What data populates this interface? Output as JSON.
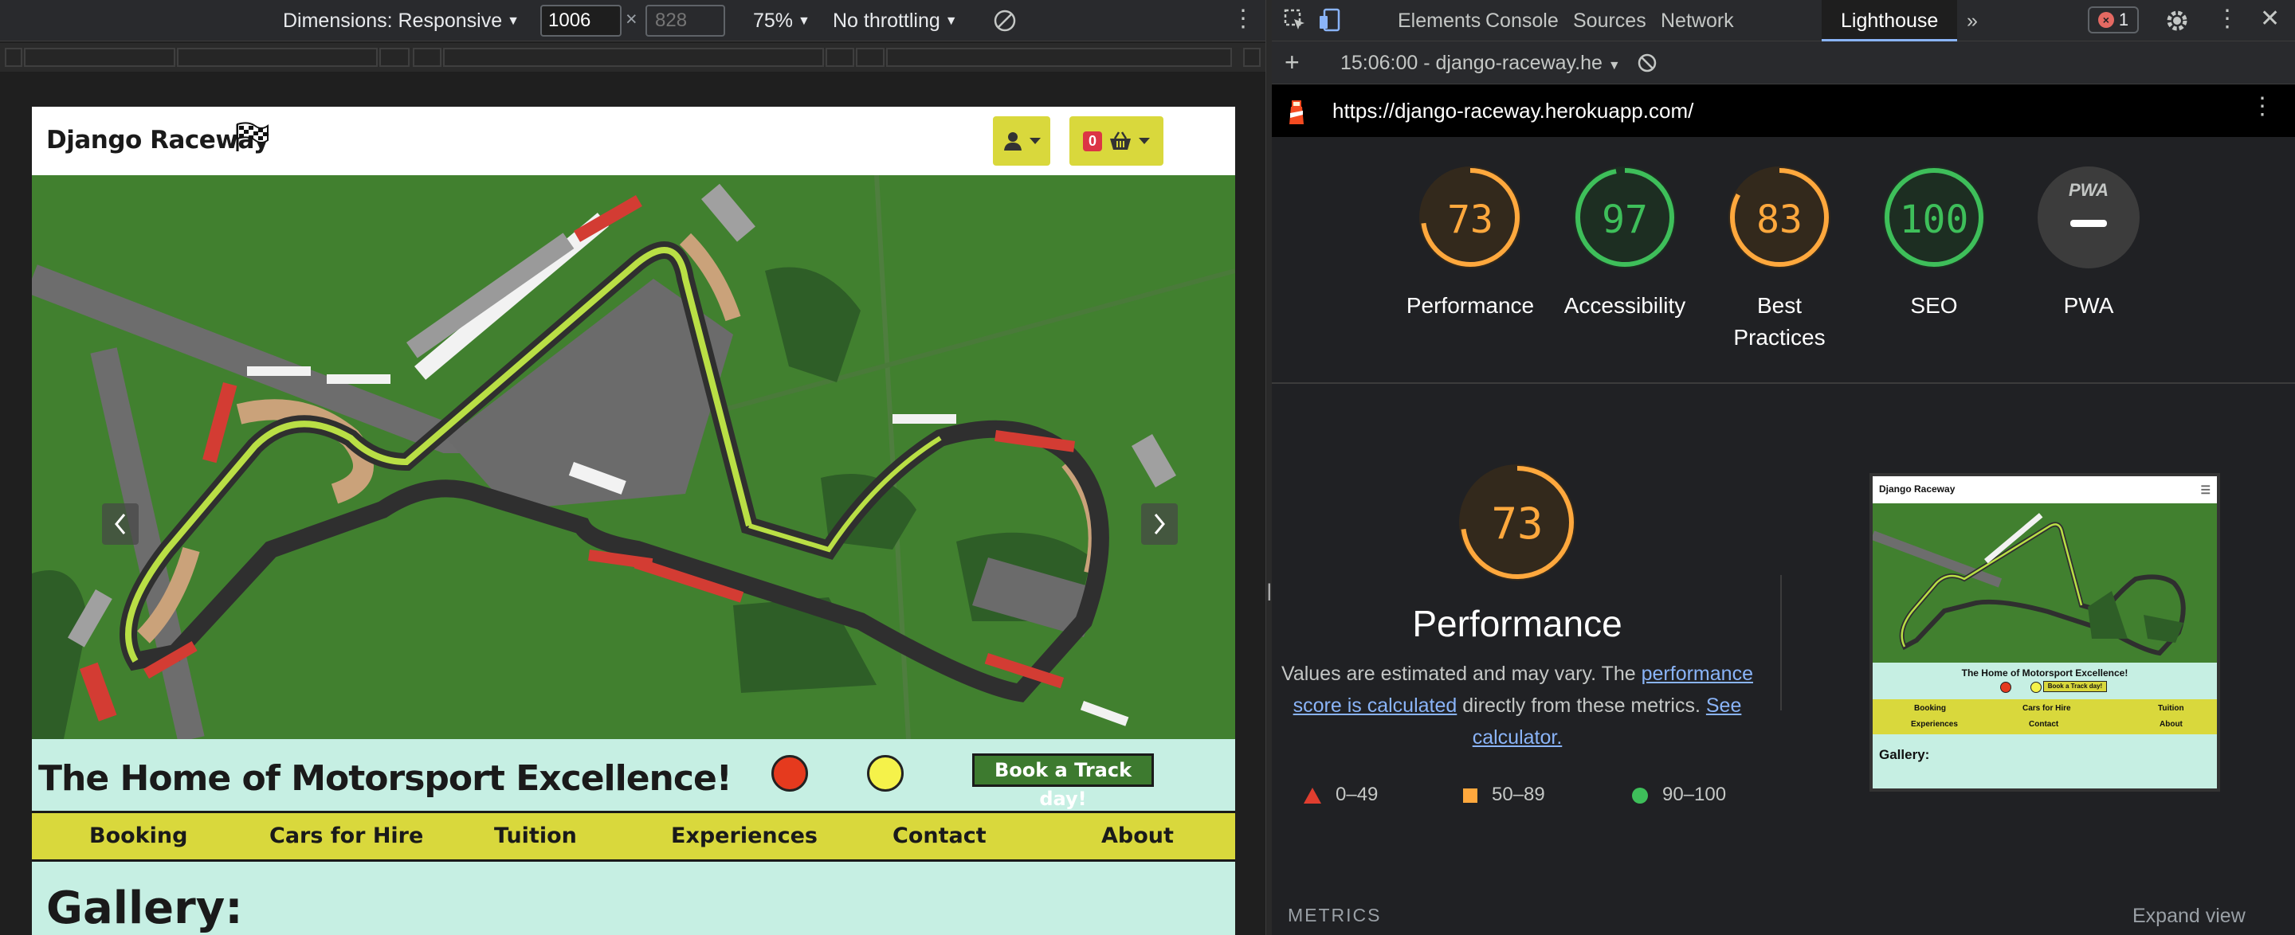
{
  "device_toolbar": {
    "dimensions_label": "Dimensions: Responsive",
    "width_value": "1006",
    "height_placeholder": "828",
    "zoom": "75%",
    "throttling": "No throttling"
  },
  "site": {
    "brand": "Django Raceway",
    "cart_count": "0",
    "tagline": "The Home of Motorsport Excellence!",
    "book_button": "Book a Track day!",
    "menu": [
      "Booking",
      "Cars for Hire",
      "Tuition",
      "Experiences",
      "Contact",
      "About"
    ],
    "gallery_title": "Gallery:",
    "colors": {
      "brand_green": "#3d7a2f",
      "accent_yellow": "#d9d83c",
      "mint": "#c6efe3"
    }
  },
  "devtools": {
    "tabs": [
      "Elements",
      "Console",
      "Sources",
      "Network",
      "Lighthouse"
    ],
    "active_tab": "Lighthouse",
    "error_count": "1",
    "session": "15:06:00 - django-raceway.he",
    "url": "https://django-raceway.herokuapp.com/"
  },
  "lighthouse": {
    "scores": [
      {
        "label": "Performance",
        "value": "73",
        "color": "#ffa83d"
      },
      {
        "label": "Accessibility",
        "value": "97",
        "color": "#3ebf5a"
      },
      {
        "label": "Best Practices",
        "value": "83",
        "color": "#ffa83d"
      },
      {
        "label": "SEO",
        "value": "100",
        "color": "#3ebf5a"
      },
      {
        "label": "PWA",
        "value": "",
        "color": "#c4c7c5"
      }
    ],
    "pwa_badge": "PWA",
    "performance": {
      "score": "73",
      "title": "Performance",
      "desc_before": "Values are estimated and may vary. The ",
      "link1": "performance score is calculated",
      "desc_middle": " directly from these metrics. ",
      "link2": "See calculator."
    },
    "legend": [
      "0–49",
      "50–89",
      "90–100"
    ],
    "metrics_label": "METRICS",
    "expand_label": "Expand view",
    "thumbnail": {
      "brand": "Django Raceway",
      "tagline": "The Home of Motorsport Excellence!",
      "book": "Book a Track day!",
      "menu": [
        "Booking",
        "Cars for Hire",
        "Tuition",
        "Experiences",
        "Contact",
        "About"
      ],
      "gallery": "Gallery:"
    }
  }
}
